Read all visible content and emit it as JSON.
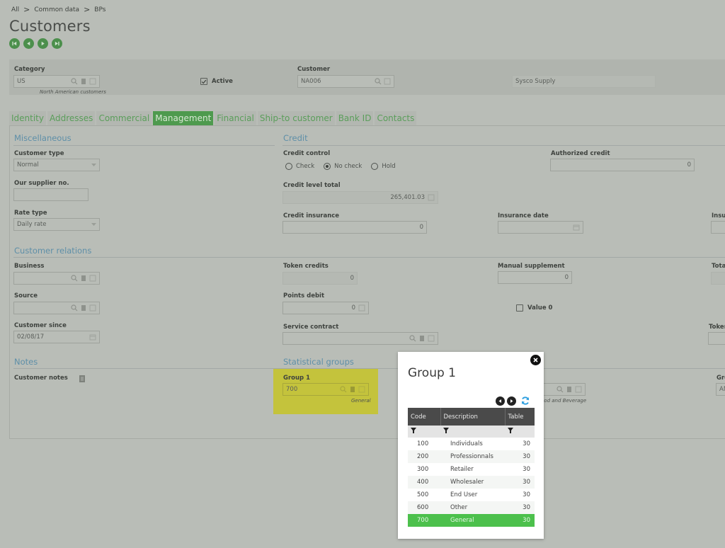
{
  "breadcrumb": [
    "All",
    "Common data",
    "BPs"
  ],
  "breadcrumb_separator": ">",
  "page_title": "Customers",
  "record_nav": {
    "buttons": [
      "first-record",
      "previous-record",
      "next-record",
      "last-record"
    ],
    "color": "#4c8f4c"
  },
  "header": {
    "category": {
      "label": "Category",
      "value": "US",
      "description": "North American customers"
    },
    "active": {
      "label": "Active",
      "checked": true
    },
    "customer": {
      "label": "Customer",
      "value": "NA006"
    },
    "customer_name": {
      "value": "Sysco Supply"
    }
  },
  "tabs": [
    {
      "label": "Identity",
      "active": false
    },
    {
      "label": "Addresses",
      "active": false
    },
    {
      "label": "Commercial",
      "active": false
    },
    {
      "label": "Management",
      "active": true
    },
    {
      "label": "Financial",
      "active": false
    },
    {
      "label": "Ship-to customer",
      "active": false
    },
    {
      "label": "Bank ID",
      "active": false
    },
    {
      "label": "Contacts",
      "active": false
    }
  ],
  "miscellaneous": {
    "title": "Miscellaneous",
    "customer_type": {
      "label": "Customer type",
      "value": "Normal"
    },
    "our_supplier_no": {
      "label": "Our supplier no.",
      "value": ""
    },
    "rate_type": {
      "label": "Rate type",
      "value": "Daily rate"
    }
  },
  "credit": {
    "title": "Credit",
    "credit_control": {
      "label": "Credit control",
      "options": [
        "Check",
        "No check",
        "Hold"
      ],
      "selected": "No check"
    },
    "authorized_credit": {
      "label": "Authorized credit",
      "value": "0"
    },
    "credit_level_total": {
      "label": "Credit level total",
      "value": "265,401.03"
    },
    "credit_insurance": {
      "label": "Credit insurance",
      "value": "0"
    },
    "insurance_date": {
      "label": "Insurance date",
      "value": ""
    },
    "insurance_truncated": {
      "label": "Insu"
    }
  },
  "customer_relations": {
    "title": "Customer relations",
    "business": {
      "label": "Business",
      "value": ""
    },
    "source": {
      "label": "Source",
      "value": ""
    },
    "customer_since": {
      "label": "Customer since",
      "value": "02/08/17"
    }
  },
  "loyalty": {
    "token_credits": {
      "label": "Token credits",
      "value": "0"
    },
    "manual_supplement": {
      "label": "Manual supplement",
      "value": "0"
    },
    "total_truncated": {
      "label": "Tota"
    },
    "points_debit": {
      "label": "Points debit",
      "value": "0"
    },
    "value_zero": {
      "label": "Value 0",
      "checked": false
    },
    "service_contract": {
      "label": "Service contract",
      "value": ""
    },
    "token_truncated": {
      "label": "Toker"
    }
  },
  "notes": {
    "title": "Notes",
    "customer_notes": {
      "label": "Customer notes"
    }
  },
  "statistical_groups": {
    "title": "Statistical groups",
    "group1": {
      "label": "Group 1",
      "value": "700",
      "description": "General"
    },
    "group2": {
      "description": "Food and Beverage"
    },
    "group_truncated": {
      "label": "Gro",
      "value": "AN"
    }
  },
  "modal": {
    "title": "Group 1",
    "columns": [
      "Code",
      "Description",
      "Table"
    ],
    "rows": [
      {
        "code": "100",
        "description": "Individuals",
        "table": "30",
        "selected": false
      },
      {
        "code": "200",
        "description": "Professionnals",
        "table": "30",
        "selected": false
      },
      {
        "code": "300",
        "description": "Retailer",
        "table": "30",
        "selected": false
      },
      {
        "code": "400",
        "description": "Wholesaler",
        "table": "30",
        "selected": false
      },
      {
        "code": "500",
        "description": "End User",
        "table": "30",
        "selected": false
      },
      {
        "code": "600",
        "description": "Other",
        "table": "30",
        "selected": false
      },
      {
        "code": "700",
        "description": "General",
        "table": "30",
        "selected": true
      }
    ],
    "selected_color": "#4cc04c"
  }
}
